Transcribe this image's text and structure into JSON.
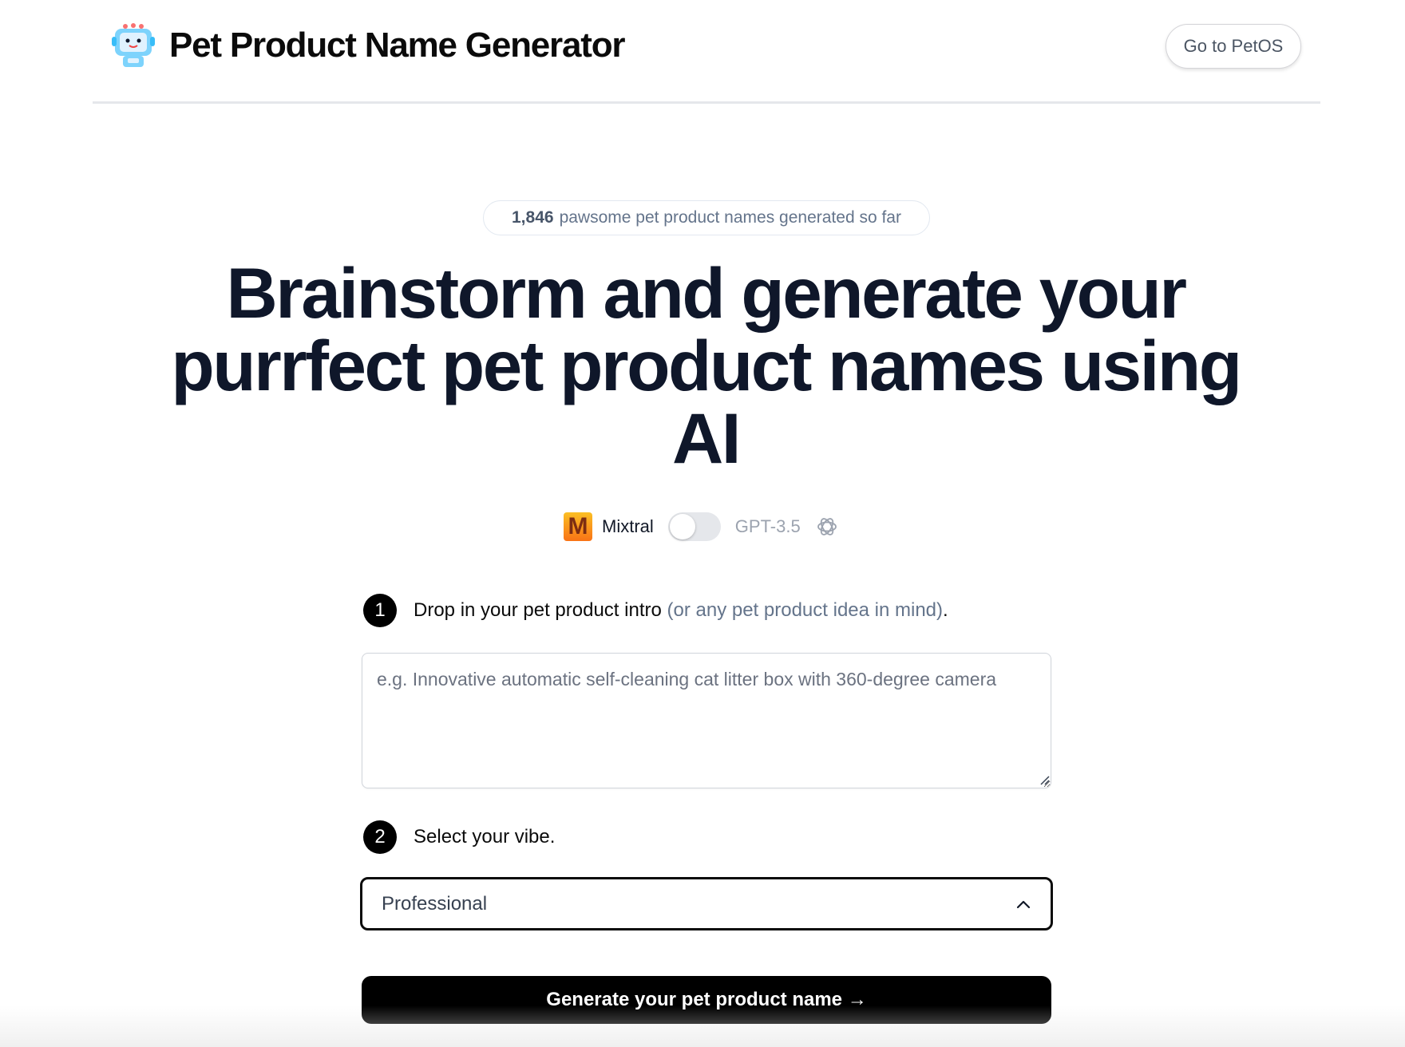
{
  "header": {
    "title": "Pet Product Name Generator",
    "logo_icon": "robot-icon",
    "petos_button": "Go to PetOS"
  },
  "counter": {
    "count": "1,846",
    "text": "pawsome pet product names generated so far"
  },
  "hero": {
    "headline": "Brainstorm and generate your purrfect pet product names using AI"
  },
  "model_toggle": {
    "left_label": "Mixtral",
    "left_icon": "mixtral-icon",
    "right_label": "GPT-3.5",
    "right_icon": "openai-icon",
    "selected": "Mixtral"
  },
  "step1": {
    "number": "1",
    "label": "Drop in your pet product intro",
    "hint": "(or any pet product idea in mind)",
    "suffix": ".",
    "placeholder": "e.g. Innovative automatic self-cleaning cat litter box with 360-degree camera"
  },
  "step2": {
    "number": "2",
    "label": "Select your vibe.",
    "selected_value": "Professional"
  },
  "generate_button": "Generate your pet product name →",
  "colors": {
    "primary": "#000000",
    "text": "#0f172a",
    "muted": "#64748b",
    "border": "#e5e7eb"
  }
}
